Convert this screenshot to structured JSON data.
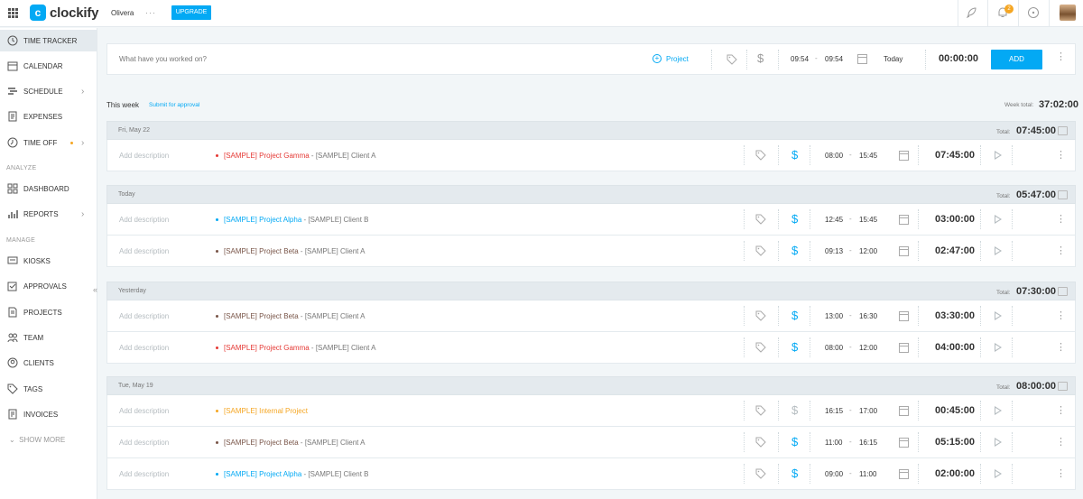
{
  "topbar": {
    "logo_text": "clockify",
    "logo_mark": "c",
    "workspace": "Olivera",
    "workspace_more": "···",
    "upgrade_label": "UPGRADE",
    "notification_count": "2",
    "icons": [
      "grid-menu-icon",
      "rocket-icon",
      "bell-icon",
      "help-icon"
    ]
  },
  "sidebar": {
    "items": [
      {
        "label": "TIME TRACKER",
        "icon": "clock-icon"
      },
      {
        "label": "CALENDAR",
        "icon": "calendar-icon"
      },
      {
        "label": "SCHEDULE",
        "icon": "schedule-icon"
      },
      {
        "label": "EXPENSES",
        "icon": "receipt-icon"
      },
      {
        "label": "TIME OFF",
        "icon": "time-off-icon"
      },
      {
        "label": "DASHBOARD",
        "icon": "dashboard-icon"
      },
      {
        "label": "REPORTS",
        "icon": "bar-chart-icon"
      },
      {
        "label": "KIOSKS",
        "icon": "kiosk-icon"
      },
      {
        "label": "APPROVALS",
        "icon": "approvals-icon"
      },
      {
        "label": "PROJECTS",
        "icon": "document-icon"
      },
      {
        "label": "TEAM",
        "icon": "team-icon"
      },
      {
        "label": "CLIENTS",
        "icon": "clients-icon"
      },
      {
        "label": "TAGS",
        "icon": "tag-icon"
      },
      {
        "label": "INVOICES",
        "icon": "invoice-icon"
      }
    ],
    "section_analyze": "ANALYZE",
    "section_manage": "MANAGE",
    "show_more": "SHOW MORE",
    "collapse": "«"
  },
  "tracker": {
    "placeholder": "What have you worked on?",
    "project_label": "Project",
    "start": "09:54",
    "end": "09:54",
    "date": "Today",
    "duration": "00:00:00",
    "add_label": "ADD"
  },
  "week": {
    "title": "This week",
    "submit_label": "Submit for approval",
    "total_label": "Week total:",
    "total": "37:02:00"
  },
  "colors": {
    "accent": "#03a9f4",
    "gamma": "#e53935",
    "alpha": "#03a9f4",
    "beta": "#795548",
    "internal": "#f5a623"
  },
  "days": [
    {
      "label": "Fri, May 22",
      "total_label": "Total:",
      "total": "07:45:00",
      "entries": [
        {
          "desc": "Add description",
          "project": "[SAMPLE] Project Gamma",
          "client": "[SAMPLE] Client A",
          "color": "#e53935",
          "billable": true,
          "start": "08:00",
          "end": "15:45",
          "duration": "07:45:00"
        }
      ]
    },
    {
      "label": "Today",
      "total_label": "Total:",
      "total": "05:47:00",
      "entries": [
        {
          "desc": "Add description",
          "project": "[SAMPLE] Project Alpha",
          "client": "[SAMPLE] Client B",
          "color": "#03a9f4",
          "billable": true,
          "start": "12:45",
          "end": "15:45",
          "duration": "03:00:00"
        },
        {
          "desc": "Add description",
          "project": "[SAMPLE] Project Beta",
          "client": "[SAMPLE] Client A",
          "color": "#795548",
          "billable": true,
          "start": "09:13",
          "end": "12:00",
          "duration": "02:47:00"
        }
      ]
    },
    {
      "label": "Yesterday",
      "total_label": "Total:",
      "total": "07:30:00",
      "entries": [
        {
          "desc": "Add description",
          "project": "[SAMPLE] Project Beta",
          "client": "[SAMPLE] Client A",
          "color": "#795548",
          "billable": true,
          "start": "13:00",
          "end": "16:30",
          "duration": "03:30:00"
        },
        {
          "desc": "Add description",
          "project": "[SAMPLE] Project Gamma",
          "client": "[SAMPLE] Client A",
          "color": "#e53935",
          "billable": true,
          "start": "08:00",
          "end": "12:00",
          "duration": "04:00:00"
        }
      ]
    },
    {
      "label": "Tue, May 19",
      "total_label": "Total:",
      "total": "08:00:00",
      "entries": [
        {
          "desc": "Add description",
          "project": "[SAMPLE] Internal Project",
          "client": "",
          "color": "#f5a623",
          "billable": false,
          "start": "16:15",
          "end": "17:00",
          "duration": "00:45:00"
        },
        {
          "desc": "Add description",
          "project": "[SAMPLE] Project Beta",
          "client": "[SAMPLE] Client A",
          "color": "#795548",
          "billable": true,
          "start": "11:00",
          "end": "16:15",
          "duration": "05:15:00"
        },
        {
          "desc": "Add description",
          "project": "[SAMPLE] Project Alpha",
          "client": "[SAMPLE] Client B",
          "color": "#03a9f4",
          "billable": true,
          "start": "09:00",
          "end": "11:00",
          "duration": "02:00:00"
        }
      ]
    }
  ]
}
